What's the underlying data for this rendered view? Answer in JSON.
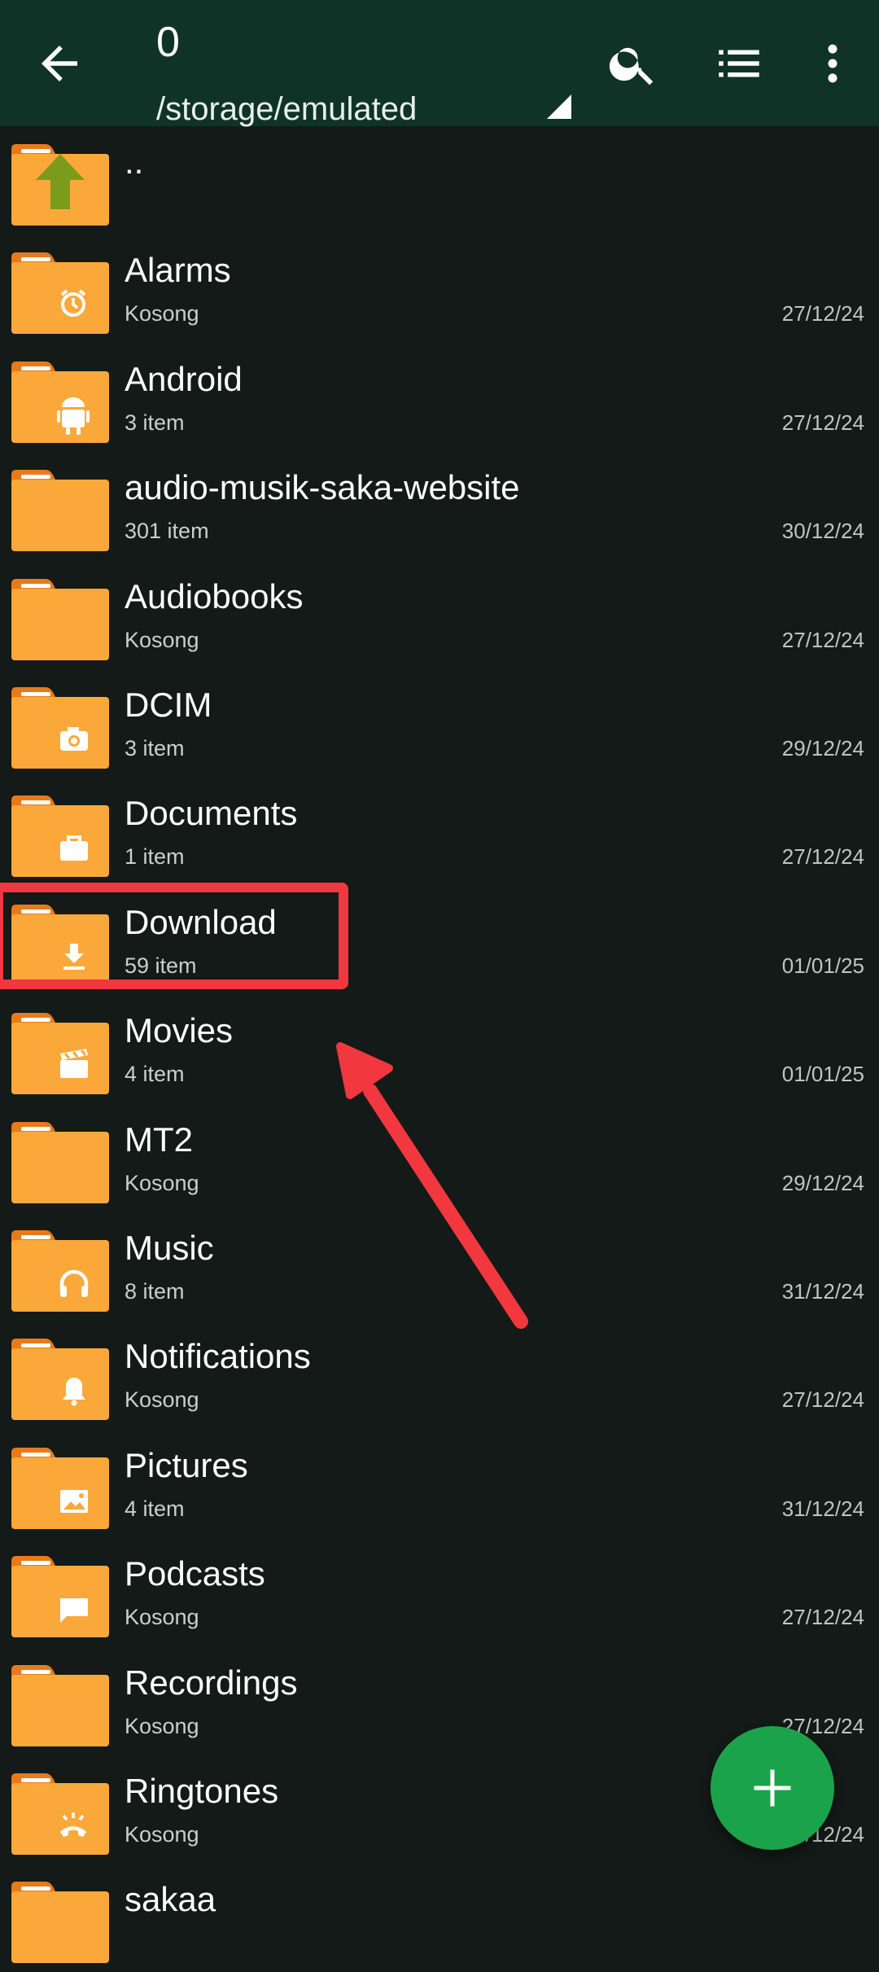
{
  "appbar": {
    "title": "0",
    "path": "/storage/emulated",
    "icons": {
      "back": "arrow-back-icon",
      "search": "search-icon",
      "view": "list-view-icon",
      "more": "more-vert-icon"
    }
  },
  "colors": {
    "appbar": "#103327",
    "background": "#131a17",
    "folder": "#fba83a",
    "folder_tab": "#e87a1a",
    "fab": "#1ba34b",
    "highlight": "#f2373f"
  },
  "files": [
    {
      "name": "..",
      "meta": "",
      "date": "",
      "icon": "parent-up-icon"
    },
    {
      "name": "Alarms",
      "meta": "Kosong",
      "date": "27/12/24",
      "icon": "alarm-icon"
    },
    {
      "name": "Android",
      "meta": "3 item",
      "date": "27/12/24",
      "icon": "android-icon"
    },
    {
      "name": "audio-musik-saka-website",
      "meta": "301 item",
      "date": "30/12/24",
      "icon": ""
    },
    {
      "name": "Audiobooks",
      "meta": "Kosong",
      "date": "27/12/24",
      "icon": ""
    },
    {
      "name": "DCIM",
      "meta": "3 item",
      "date": "29/12/24",
      "icon": "camera-icon"
    },
    {
      "name": "Documents",
      "meta": "1 item",
      "date": "27/12/24",
      "icon": "briefcase-icon"
    },
    {
      "name": "Download",
      "meta": "59 item",
      "date": "01/01/25",
      "icon": "download-icon"
    },
    {
      "name": "Movies",
      "meta": "4 item",
      "date": "01/01/25",
      "icon": "clapper-icon"
    },
    {
      "name": "MT2",
      "meta": "Kosong",
      "date": "29/12/24",
      "icon": ""
    },
    {
      "name": "Music",
      "meta": "8 item",
      "date": "31/12/24",
      "icon": "headphones-icon"
    },
    {
      "name": "Notifications",
      "meta": "Kosong",
      "date": "27/12/24",
      "icon": "bell-icon"
    },
    {
      "name": "Pictures",
      "meta": "4 item",
      "date": "31/12/24",
      "icon": "image-icon"
    },
    {
      "name": "Podcasts",
      "meta": "Kosong",
      "date": "27/12/24",
      "icon": "chat-bubble-icon"
    },
    {
      "name": "Recordings",
      "meta": "Kosong",
      "date": "27/12/24",
      "icon": ""
    },
    {
      "name": "Ringtones",
      "meta": "Kosong",
      "date": "27/12/24",
      "icon": "ringtone-icon"
    },
    {
      "name": "sakaa",
      "meta": "",
      "date": "",
      "icon": ""
    }
  ],
  "fab": {
    "icon": "plus-icon"
  }
}
